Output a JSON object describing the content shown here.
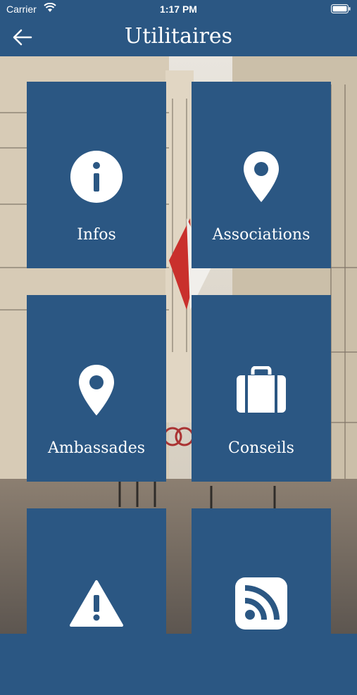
{
  "status": {
    "carrier": "Carrier",
    "time": "1:17 PM"
  },
  "header": {
    "title": "Utilitaires",
    "back_icon": "back-arrow-icon"
  },
  "colors": {
    "brand": "#2b5783",
    "text": "#ffffff"
  },
  "tiles": [
    {
      "label": "Infos",
      "icon": "info-icon"
    },
    {
      "label": "Associations",
      "icon": "location-pin-icon"
    },
    {
      "label": "Ambassades",
      "icon": "location-pin-icon"
    },
    {
      "label": "Conseils",
      "icon": "suitcase-icon"
    },
    {
      "label": "",
      "icon": "warning-icon"
    },
    {
      "label": "",
      "icon": "rss-feed-icon"
    }
  ]
}
